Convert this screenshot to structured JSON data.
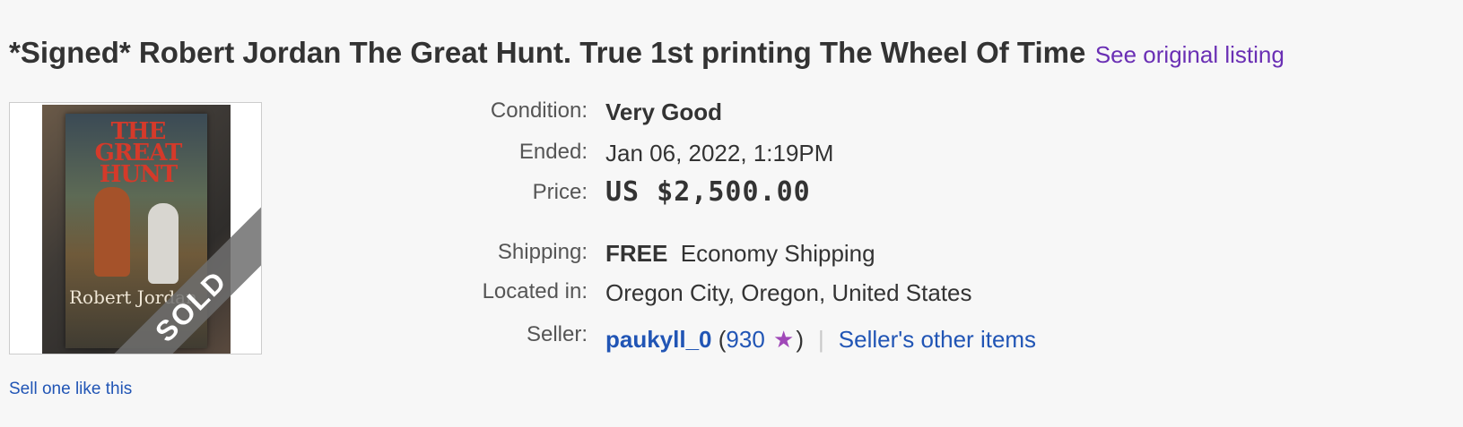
{
  "listing": {
    "title": "*Signed* Robert Jordan The Great Hunt. True 1st printing The Wheel Of Time",
    "see_original_label": "See original listing"
  },
  "image": {
    "book_title": "THE GREAT HUNT",
    "book_author": "Robert Jordan",
    "sold_badge": "SOLD"
  },
  "sell_one_label": "Sell one like this",
  "details": {
    "condition_label": "Condition:",
    "condition_value": "Very Good",
    "ended_label": "Ended:",
    "ended_date": "Jan 06, 2022",
    "ended_time": "1:19PM",
    "price_label": "Price:",
    "price_value": "US $2,500.00",
    "shipping_label": "Shipping:",
    "shipping_free": "FREE",
    "shipping_method": "Economy Shipping",
    "location_label": "Located in:",
    "location_value": "Oregon City, Oregon, United States",
    "seller_label": "Seller:",
    "seller_name": "paukyll_0",
    "seller_open_paren": "(",
    "seller_feedback": "930",
    "seller_close_paren": ")",
    "seller_star_icon": "purple-star-icon",
    "separator": "|",
    "other_items_label": "Seller's other items"
  },
  "colors": {
    "link": "#2155b5",
    "visited_link": "#6a2fb4",
    "star": "#a048b8",
    "text": "#333333",
    "background": "#f7f7f7"
  }
}
